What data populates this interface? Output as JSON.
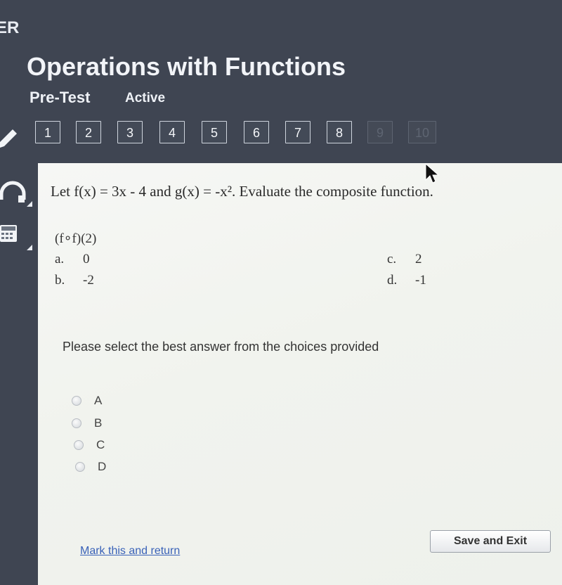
{
  "header": {
    "brand_fragment": "ER",
    "title": "Operations with Functions",
    "subtitle": "Pre-Test",
    "status": "Active"
  },
  "question_nav": {
    "items": [
      {
        "label": "1",
        "enabled": true
      },
      {
        "label": "2",
        "enabled": true
      },
      {
        "label": "3",
        "enabled": true
      },
      {
        "label": "4",
        "enabled": true
      },
      {
        "label": "5",
        "enabled": true
      },
      {
        "label": "6",
        "enabled": true
      },
      {
        "label": "7",
        "enabled": true
      },
      {
        "label": "8",
        "enabled": true
      },
      {
        "label": "9",
        "enabled": false
      },
      {
        "label": "10",
        "enabled": false
      }
    ]
  },
  "tools": [
    {
      "icon": "pencil-icon"
    },
    {
      "icon": "headphones-icon"
    },
    {
      "icon": "calculator-icon"
    }
  ],
  "question": {
    "prompt": "Let f(x) = 3x - 4 and g(x) = -x². Evaluate the composite function.",
    "expression": "(f∘f)(2)",
    "choices": [
      {
        "letter": "a.",
        "value": "0"
      },
      {
        "letter": "b.",
        "value": "-2"
      },
      {
        "letter": "c.",
        "value": "2"
      },
      {
        "letter": "d.",
        "value": "-1"
      }
    ]
  },
  "answer": {
    "instruction": "Please select the best answer from the choices provided",
    "options": [
      "A",
      "B",
      "C",
      "D"
    ],
    "selected": null
  },
  "footer": {
    "mark_link": "Mark this and return",
    "save_button": "Save and Exit"
  }
}
